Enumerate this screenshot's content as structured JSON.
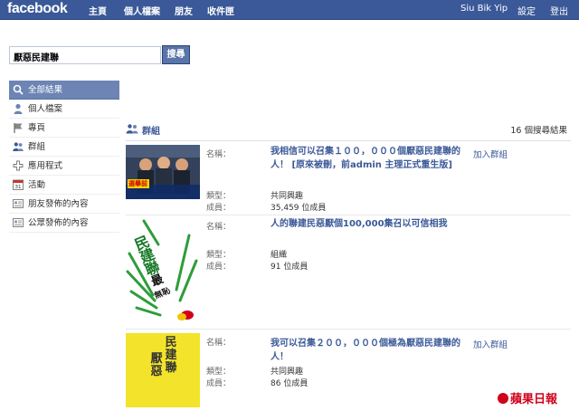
{
  "topbar": {
    "logo": "facebook",
    "nav": [
      "主頁",
      "個人檔案",
      "朋友",
      "收件匣"
    ],
    "user": "Siu Bik Yip",
    "settings": "設定",
    "logout": "登出"
  },
  "search": {
    "value": "厭惡民建聯",
    "button": "搜尋"
  },
  "sidebar": {
    "items": [
      {
        "label": "全部結果",
        "icon": "search-icon",
        "active": true
      },
      {
        "label": "個人檔案",
        "icon": "person-icon"
      },
      {
        "label": "專頁",
        "icon": "page-icon"
      },
      {
        "label": "群組",
        "icon": "group-icon"
      },
      {
        "label": "應用程式",
        "icon": "plus-icon"
      },
      {
        "label": "活動",
        "icon": "calendar-icon"
      },
      {
        "label": "朋友發佈的內容",
        "icon": "post-icon"
      },
      {
        "label": "公眾發佈的內容",
        "icon": "post-icon"
      }
    ]
  },
  "results": {
    "title": "群組",
    "count": "16 個搜尋結果",
    "labels": {
      "name": "名稱：",
      "type": "類型：",
      "members": "成員："
    },
    "items": [
      {
        "name": "我相信可以召集１００，０００個厭惡民建聯的人！ [原來被刪，前admin 主理正式重生版]",
        "type": "共同興趣",
        "members": "35,459 位成員",
        "join": "加入群組",
        "thumb_caption": "選舉前"
      },
      {
        "name": "人的聯建民惡厭個100,000集召以可信相我",
        "type": "組織",
        "members": "91 位成員",
        "join": "",
        "thumb_text": [
          "民",
          "建",
          "聯",
          "最",
          "無",
          "恥"
        ]
      },
      {
        "name": "我可以召集２００，０００個極為厭惡民建聯的人！",
        "type": "共同興趣",
        "members": "86 位成員",
        "join": "加入群組",
        "thumb_text": [
          "厭",
          "惡",
          "民",
          "建",
          "聯"
        ]
      }
    ]
  },
  "watermark": "蘋果日報",
  "colors": {
    "brand": "#3b5998",
    "active": "#6d84b4",
    "watermark": "#d0021b",
    "thumb_yellow": "#f3e32a"
  }
}
